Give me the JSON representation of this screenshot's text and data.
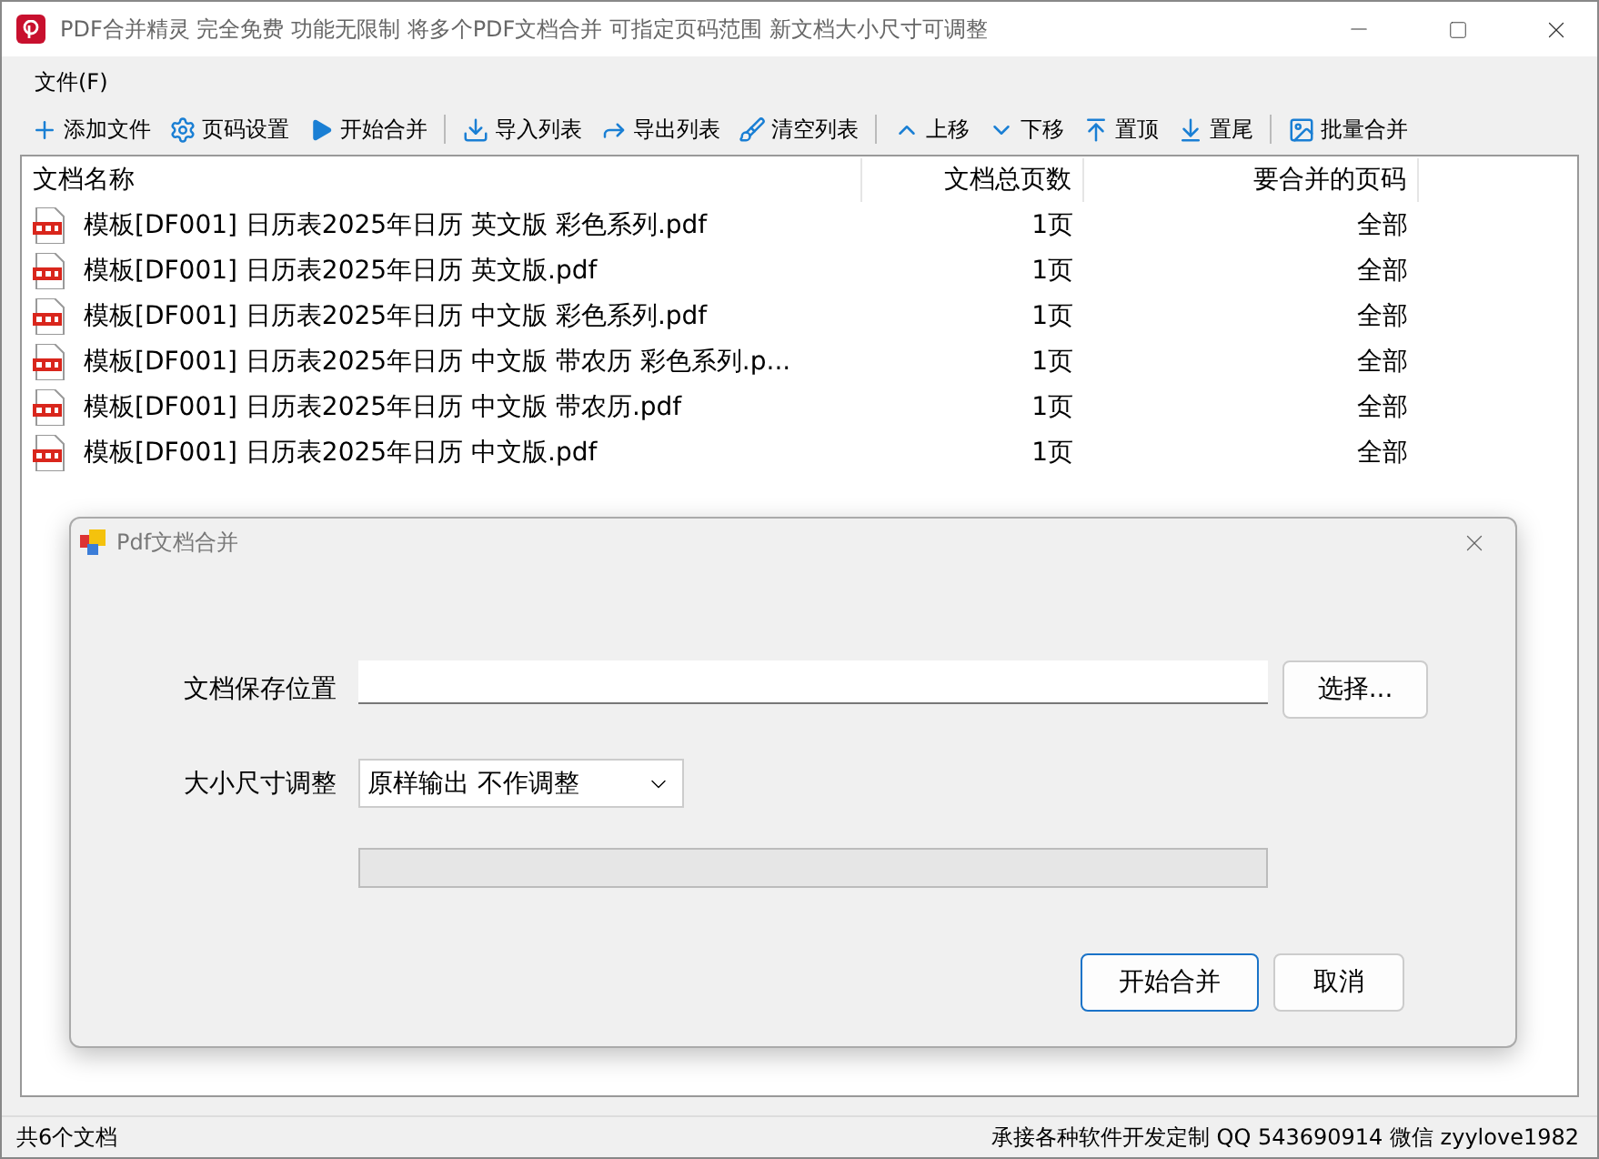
{
  "window": {
    "title": "PDF合并精灵 完全免费 功能无限制 将多个PDF文档合并 可指定页码范围 新文档大小尺寸可调整"
  },
  "menu": [
    "文件(F)"
  ],
  "toolbar": [
    {
      "kind": "button",
      "label": "添加文件"
    },
    {
      "kind": "button",
      "label": "页码设置"
    },
    {
      "kind": "button",
      "label": "开始合并"
    },
    {
      "kind": "separator"
    },
    {
      "kind": "button",
      "label": "导入列表"
    },
    {
      "kind": "button",
      "label": "导出列表"
    },
    {
      "kind": "button",
      "label": "清空列表"
    },
    {
      "kind": "separator"
    },
    {
      "kind": "button",
      "label": "上移"
    },
    {
      "kind": "button",
      "label": "下移"
    },
    {
      "kind": "button",
      "label": "置顶"
    },
    {
      "kind": "button",
      "label": "置尾"
    },
    {
      "kind": "separator"
    },
    {
      "kind": "button",
      "label": "批量合并"
    }
  ],
  "table": {
    "columns": [
      "文档名称",
      "文档总页数",
      "要合并的页码"
    ],
    "rows": [
      {
        "name": "模板[DF001] 日历表2025年日历 英文版 彩色系列.pdf",
        "pages": "1页",
        "range": "全部"
      },
      {
        "name": "模板[DF001] 日历表2025年日历 英文版.pdf",
        "pages": "1页",
        "range": "全部"
      },
      {
        "name": "模板[DF001] 日历表2025年日历 中文版 彩色系列.pdf",
        "pages": "1页",
        "range": "全部"
      },
      {
        "name": "模板[DF001] 日历表2025年日历 中文版 带农历 彩色系列.p...",
        "pages": "1页",
        "range": "全部"
      },
      {
        "name": "模板[DF001] 日历表2025年日历 中文版 带农历.pdf",
        "pages": "1页",
        "range": "全部"
      },
      {
        "name": "模板[DF001] 日历表2025年日历 中文版.pdf",
        "pages": "1页",
        "range": "全部"
      }
    ]
  },
  "dialog": {
    "title": "Pdf文档合并",
    "save_label": "文档保存位置",
    "choose_button": "选择...",
    "size_label": "大小尺寸调整",
    "size_value": "原样输出 不作调整",
    "progress": {
      "level": 0
    },
    "buttons": [
      {
        "label": "开始合并",
        "focused": true
      },
      {
        "label": "取消",
        "focused": false
      }
    ]
  },
  "status_bar": {
    "left": "共6个文档",
    "right": "承接各种软件开发定制 QQ 543690914 微信 zyylove1982"
  }
}
